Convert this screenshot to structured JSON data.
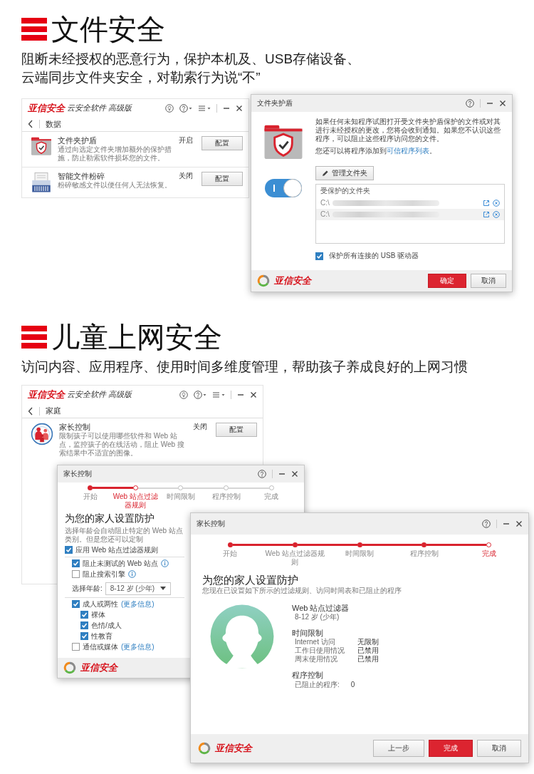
{
  "file_security": {
    "heading": "文件安全",
    "description_lines": [
      "阻断未经授权的恶意行为，保护本机及、USB存储设备、",
      "云端同步文件夹安全，对勒索行为说“不”"
    ],
    "app_window": {
      "brand": "亚信安全",
      "product": "云安全软件 高级版",
      "section": "数据",
      "features": [
        {
          "kind": "folder",
          "name": "文件夹护盾",
          "description": "通过向选定文件夹增加额外的保护措施，防止勒索软件损坏您的文件。",
          "status": "开启",
          "button": "配置"
        },
        {
          "kind": "shredder",
          "name": "智能文件粉碎",
          "description": "粉碎敏感文件以便任何人无法恢复。",
          "status": "关闭",
          "button": "配置"
        }
      ]
    },
    "dialog": {
      "title": "文件夹护盾",
      "toggle_on": true,
      "intro": "如果任何未知程序试图打开受文件夹护盾保护的文件或对其进行未经授权的更改，您将会收到通知。如果您不认识这些程序，可以阻止这些程序访问您的文件。",
      "trusted_prefix": "您还可以将程序添加到",
      "trusted_link": "可信程序列表",
      "trusted_suffix": "。",
      "manage_button": "管理文件夹",
      "folders_header": "受保护的文件夹",
      "folders": [
        {
          "path": "C:\\"
        },
        {
          "path": "C:\\"
        }
      ],
      "usb_label": "保护所有连接的 USB 驱动器",
      "usb_checked": true,
      "brand": "亚信安全",
      "buttons": [
        {
          "label": "确定",
          "kind": "primary"
        },
        {
          "label": "取消",
          "kind": "secondary"
        }
      ]
    }
  },
  "child_safety": {
    "heading": "儿童上网安全",
    "description": "访问内容、应用程序、使用时间多维度管理，帮助孩子养成良好的上网习惯",
    "app_window": {
      "brand": "亚信安全",
      "product": "云安全软件 高级版",
      "section": "家庭",
      "features": [
        {
          "kind": "family",
          "name": "家长控制",
          "description": "限制孩子可以使用哪些软件和 Web 站点，监控孩子的在线活动，阻止 Web 搜索结果中不适宜的图像。",
          "status": "关闭",
          "button": "配置"
        }
      ]
    },
    "wizard_back": {
      "title": "家长控制",
      "steps": [
        {
          "label": "开始",
          "completed": true,
          "current": false
        },
        {
          "label": "Web 站点过滤器规则",
          "completed": false,
          "current": true
        },
        {
          "label": "时间限制",
          "completed": false,
          "current": false
        },
        {
          "label": "程序控制",
          "completed": false,
          "current": false
        },
        {
          "label": "完成",
          "completed": false,
          "current": false
        }
      ],
      "heading": "为您的家人设置防护",
      "subtitle": "选择年龄会自动阻止特定的 Web 站点类别。但是您还可以定制",
      "apply_label": "应用 Web 站点过滤器规则",
      "apply_checked": true,
      "options": [
        {
          "label": "阻止未测试的 Web 站点",
          "checked": true
        },
        {
          "label": "阻止搜索引擎",
          "checked": false
        }
      ],
      "age_label": "选择年龄:",
      "age_value": "8-12 岁 (少年)",
      "categories": [
        {
          "label": "成人或两性",
          "more": "(更多信息)",
          "checked": true,
          "children": [
            {
              "label": "裸体",
              "checked": true
            },
            {
              "label": "色情/成人",
              "checked": true
            },
            {
              "label": "性教育",
              "checked": true
            }
          ]
        },
        {
          "label": "通信或媒体",
          "more": "(更多信息)",
          "checked": false
        }
      ],
      "brand": "亚信安全"
    },
    "wizard_front": {
      "title": "家长控制",
      "steps": [
        {
          "label": "开始",
          "completed": true,
          "current": false
        },
        {
          "label": "Web 站点过滤器规则",
          "completed": true,
          "current": false
        },
        {
          "label": "时间限制",
          "completed": true,
          "current": false
        },
        {
          "label": "程序控制",
          "completed": true,
          "current": false
        },
        {
          "label": "完成",
          "completed": false,
          "current": true
        }
      ],
      "heading": "为您的家人设置防护",
      "subtitle": "您现在已设置如下所示的过滤规则、访问时间表和已阻止的程序",
      "web_heading": "Web 站点过滤器",
      "web_value": "8-12 岁 (少年)",
      "time_heading": "时间限制",
      "time_rows": [
        {
          "label": "Internet 访问",
          "value": "无限制"
        },
        {
          "label": "工作日使用情况",
          "value": "已禁用"
        },
        {
          "label": "周末使用情况",
          "value": "已禁用"
        }
      ],
      "program_heading": "程序控制",
      "program_label": "已阻止的程序:",
      "program_value": "0",
      "brand": "亚信安全",
      "buttons": [
        {
          "label": "上一步",
          "kind": "secondary"
        },
        {
          "label": "完成",
          "kind": "primary"
        },
        {
          "label": "取消",
          "kind": "secondary"
        }
      ]
    }
  }
}
